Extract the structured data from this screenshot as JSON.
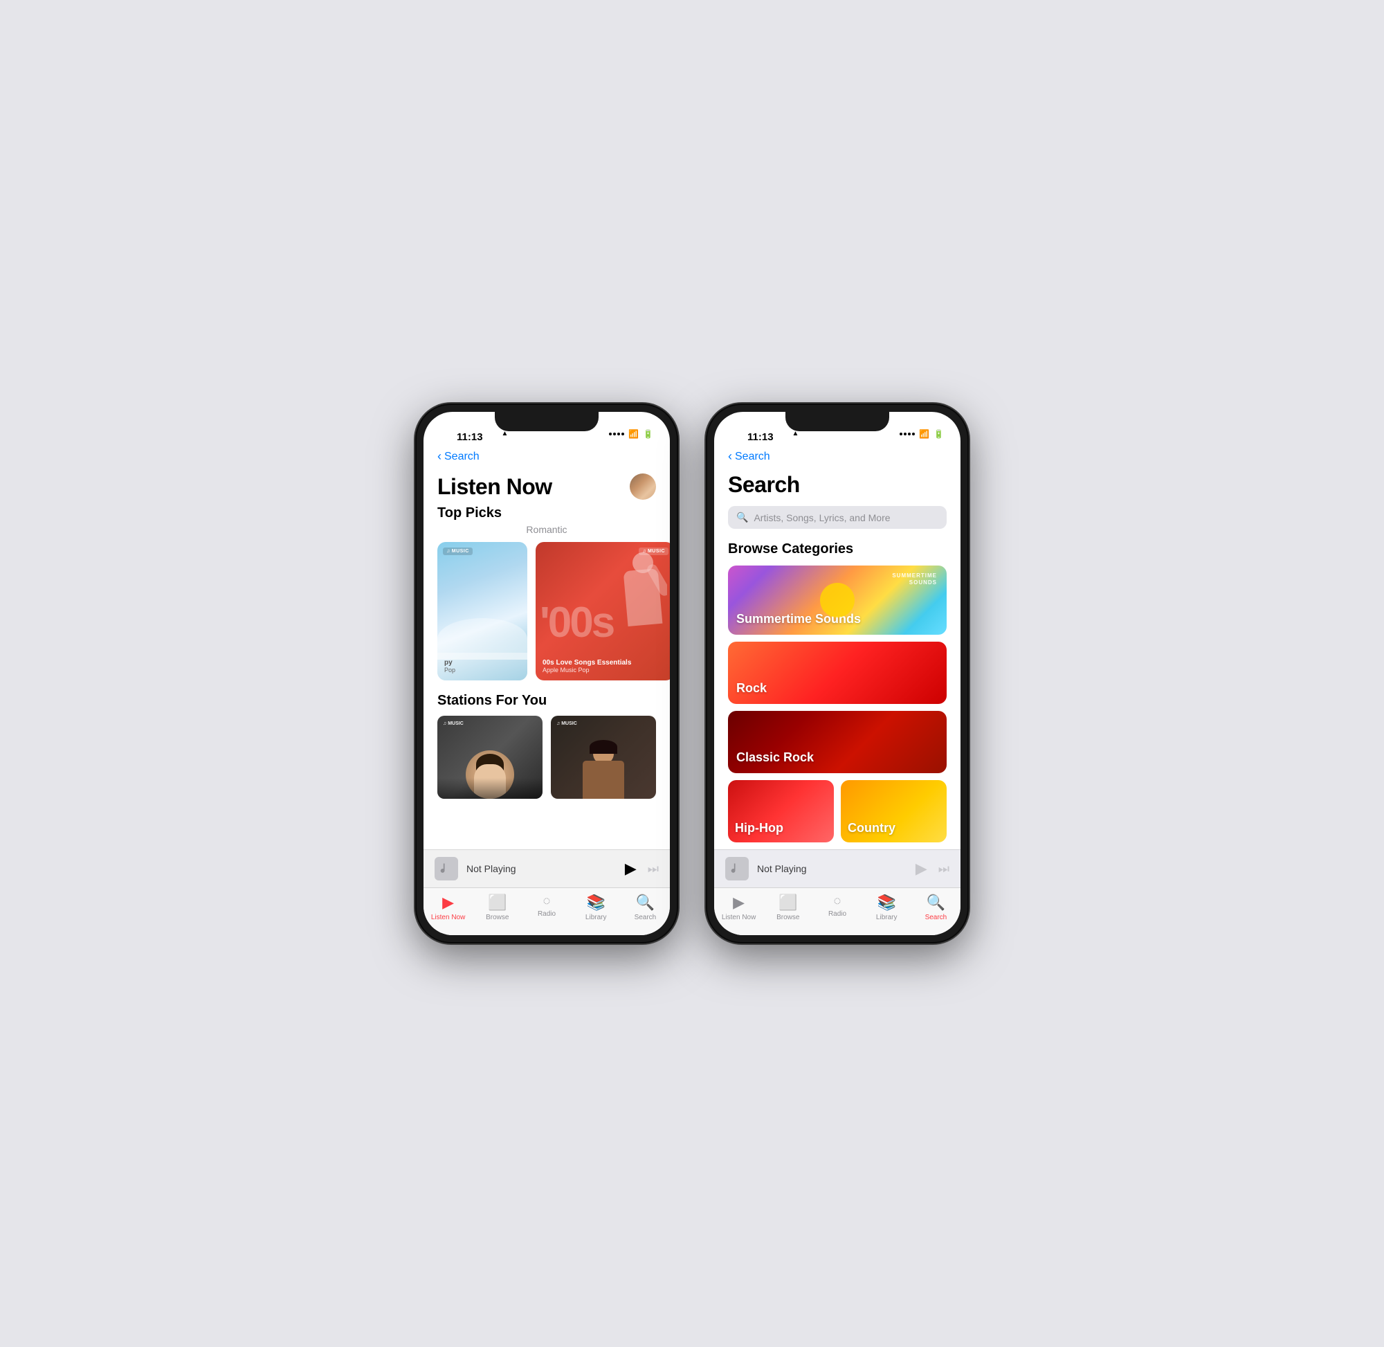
{
  "phone1": {
    "status": {
      "time": "11:13",
      "hasLocation": true,
      "signal": [
        "dot",
        "dot",
        "dot",
        "dot"
      ],
      "wifi": "wifi",
      "battery": "battery"
    },
    "backNav": "Search",
    "pageTitle": "Listen Now",
    "avatarAlt": "user avatar",
    "topPicks": {
      "sectionTitle": "Top Picks",
      "subtitle": "Romantic",
      "cards": [
        {
          "type": "partial",
          "badge": "MUSIC",
          "cardLabel": "py",
          "cardSub": "Pop"
        },
        {
          "type": "main",
          "badge": "MUSIC",
          "big00s": "'00s",
          "title": "00s Love Songs Essentials",
          "subtitle": "Apple Music Pop"
        }
      ]
    },
    "stationsForYou": {
      "sectionTitle": "Stations For You",
      "cards": [
        {
          "badge": "MUSIC",
          "type": "station1"
        },
        {
          "badge": "MUSIC",
          "type": "station2"
        }
      ]
    },
    "miniPlayer": {
      "notPlaying": "Not Playing"
    },
    "tabBar": {
      "tabs": [
        {
          "id": "listen-now",
          "label": "Listen Now",
          "icon": "▶",
          "active": true
        },
        {
          "id": "browse",
          "label": "Browse",
          "icon": "⊞",
          "active": false
        },
        {
          "id": "radio",
          "label": "Radio",
          "icon": "((·))",
          "active": false
        },
        {
          "id": "library",
          "label": "Library",
          "icon": "☰",
          "active": false
        },
        {
          "id": "search",
          "label": "Search",
          "icon": "⌕",
          "active": false
        }
      ]
    }
  },
  "phone2": {
    "status": {
      "time": "11:13",
      "hasLocation": true
    },
    "backNav": "Search",
    "pageTitle": "Search",
    "searchPlaceholder": "Artists, Songs, Lyrics, and More",
    "browseCategories": {
      "sectionTitle": "Browse Categories",
      "categories": [
        {
          "id": "summertime",
          "label": "Summertime Sounds",
          "labelTop": "SUMMERTIME\nSOUNDS",
          "type": "summertime"
        },
        {
          "id": "rock",
          "label": "Rock",
          "type": "rock"
        },
        {
          "id": "classic-rock",
          "label": "Classic Rock",
          "type": "classic-rock"
        },
        {
          "id": "hiphop",
          "label": "Hip-Hop",
          "type": "hiphop"
        },
        {
          "id": "country",
          "label": "Country",
          "type": "country"
        }
      ]
    },
    "miniPlayer": {
      "notPlaying": "Not Playing"
    },
    "tabBar": {
      "tabs": [
        {
          "id": "listen-now",
          "label": "Listen Now",
          "icon": "▶",
          "active": false
        },
        {
          "id": "browse",
          "label": "Browse",
          "icon": "⊞",
          "active": false
        },
        {
          "id": "radio",
          "label": "Radio",
          "icon": "((·))",
          "active": false
        },
        {
          "id": "library",
          "label": "Library",
          "icon": "☰",
          "active": false
        },
        {
          "id": "search",
          "label": "Search",
          "icon": "⌕",
          "active": true
        }
      ]
    }
  }
}
